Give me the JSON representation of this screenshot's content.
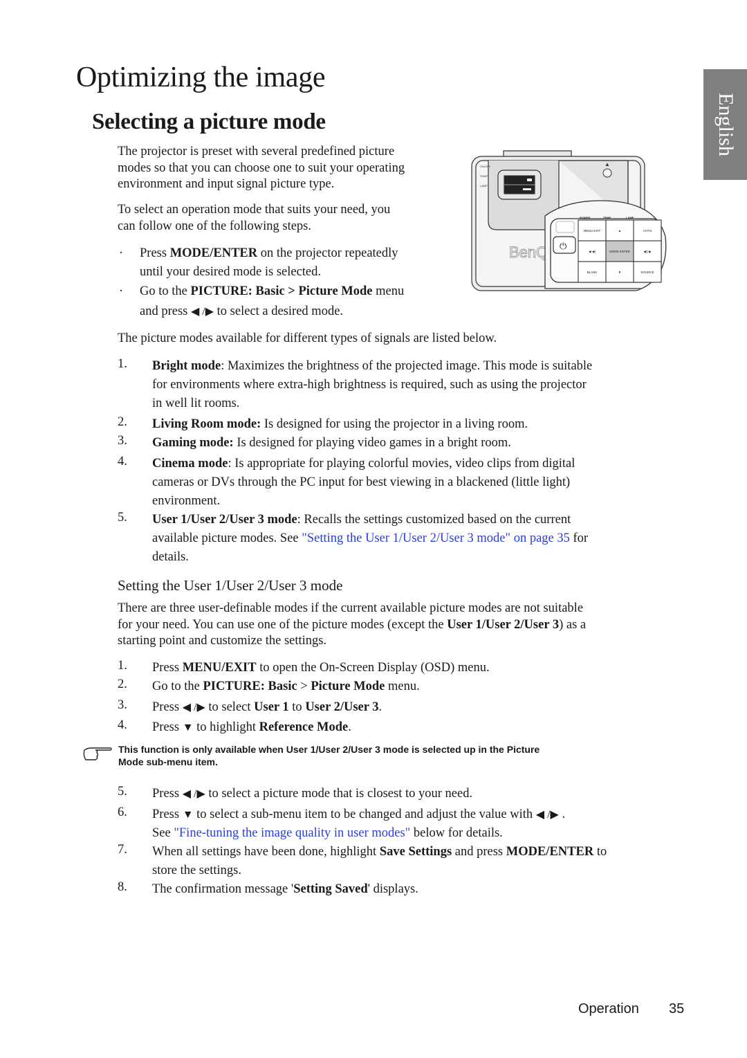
{
  "page": {
    "title": "Optimizing the image",
    "language_tab": "English",
    "section_title": "Selecting a picture mode",
    "intro_1": "The projector is preset with several predefined picture modes so that you can choose one to suit your operating environment and input signal picture type.",
    "intro_1_lines": [
      "The projector is preset with several predefined picture",
      "modes so that you can choose one to suit your operating",
      "environment and input signal picture type."
    ],
    "intro_2_lines": [
      "To select an operation mode that suits your need, you",
      "can follow one of the following steps."
    ],
    "bullets": [
      {
        "pre": "Press ",
        "bold": "MODE/ENTER",
        "post": " on the projector repeatedly",
        "line2": "until your desired mode is selected."
      },
      {
        "pre": "Go to the ",
        "bold": "PICTURE: Basic > Picture Mode",
        "post": " menu",
        "line2_pre": "and press ",
        "line2_arrows": "◀ /▶",
        "line2_post": "  to select a desired mode."
      }
    ],
    "modes_intro": "The picture modes available for different types of signals are listed below.",
    "modes": [
      {
        "num": "1.",
        "name": "Bright mode",
        "sep": ": ",
        "lines": [
          "Maximizes the brightness of the projected image. This mode is suitable",
          "for environments where extra-high brightness is required, such as using the projector",
          "in well lit rooms."
        ]
      },
      {
        "num": "2.",
        "name": "Living Room mode:",
        "sep": " ",
        "lines": [
          "Is designed for using the projector in a living room."
        ]
      },
      {
        "num": "3.",
        "name": "Gaming mode:",
        "sep": " ",
        "lines": [
          "Is designed for playing video games in a bright room."
        ]
      },
      {
        "num": "4.",
        "name": "Cinema mode",
        "sep": ": ",
        "lines": [
          "Is appropriate for playing colorful movies, video clips from digital",
          "cameras or DVs through the PC input for best viewing in a blackened (little light)",
          "environment."
        ]
      },
      {
        "num": "5.",
        "name": "User 1/User 2/User 3 mode",
        "sep": ": ",
        "lines": [
          "Recalls the settings customized based on the current"
        ],
        "line2_pre": "available picture modes. See ",
        "line2_link": "\"Setting the User 1/User 2/User 3 mode\" on page 35",
        "line2_post": " for",
        "line3": "details."
      }
    ],
    "subsection_title": "Setting the User 1/User 2/User 3 mode",
    "sub_intro": {
      "line1": "There are three user-definable modes if the current available picture modes are not suitable",
      "line2_pre": "for your need. You can use one of the picture modes (except the ",
      "line2_bold": "User 1/User 2/User 3",
      "line2_post": ") as a",
      "line3": "starting point and customize the settings."
    },
    "steps_a": [
      {
        "num": "1.",
        "pre": "Press ",
        "bold": "MENU/EXIT",
        "post": " to open the On-Screen Display (OSD) menu."
      },
      {
        "num": "2.",
        "pre": "Go to the ",
        "bold": "PICTURE: Basic",
        "mid": " > ",
        "bold2": "Picture Mode",
        "post": " menu."
      },
      {
        "num": "3.",
        "pre": "Press ",
        "arrows": "◀ /▶",
        "mid": "  to select ",
        "bold": "User 1",
        "mid2": " to ",
        "bold2": "User 2/User 3",
        "post": "."
      },
      {
        "num": "4.",
        "pre": "Press ",
        "arrows": "▼",
        "mid": "  to highlight ",
        "bold": "Reference Mode",
        "post": "."
      }
    ],
    "note": {
      "icon": "pointing-hand-icon",
      "line1": "This function is only available when User 1/User 2/User 3 mode is selected up in the Picture",
      "line2": "Mode sub-menu item."
    },
    "steps_b": [
      {
        "num": "5.",
        "pre": "Press ",
        "arrows": "◀ /▶",
        "post": "  to select a picture mode that is closest to your need."
      },
      {
        "num": "6.",
        "pre": "Press ",
        "arrows": "▼",
        "post": "  to select a sub-menu item to be changed and adjust the value with ",
        "arrows2": "◀ /▶",
        "end": " .",
        "line2_pre": "See ",
        "line2_link": "\"Fine-tuning the image quality in user modes\"",
        "line2_post": " below for details."
      },
      {
        "num": "7.",
        "pre": "When all settings have been done, highlight ",
        "bold": "Save Settings",
        "mid": " and press ",
        "bold2": "MODE/ENTER",
        "post": " to",
        "line2": "store the settings."
      },
      {
        "num": "8.",
        "pre": "The confirmation message '",
        "bold": "Setting Saved",
        "post": "' displays."
      }
    ],
    "footer": {
      "section": "Operation",
      "page_number": "35"
    },
    "figure": {
      "brand": "BenQ",
      "keypad": {
        "top_labels": [
          "POWER",
          "TEMP",
          "LAMP"
        ],
        "keys": [
          "MENU EXIT",
          "▲",
          "AUTO",
          "◀ ◀)",
          "MODE ENTER",
          "◀)) ▶",
          "BLANK",
          "▼",
          "SOURCE"
        ]
      }
    },
    "colors": {
      "link": "#2b3fd6",
      "tab_bg": "#7f7f7f",
      "text": "#1a1a1a"
    }
  }
}
